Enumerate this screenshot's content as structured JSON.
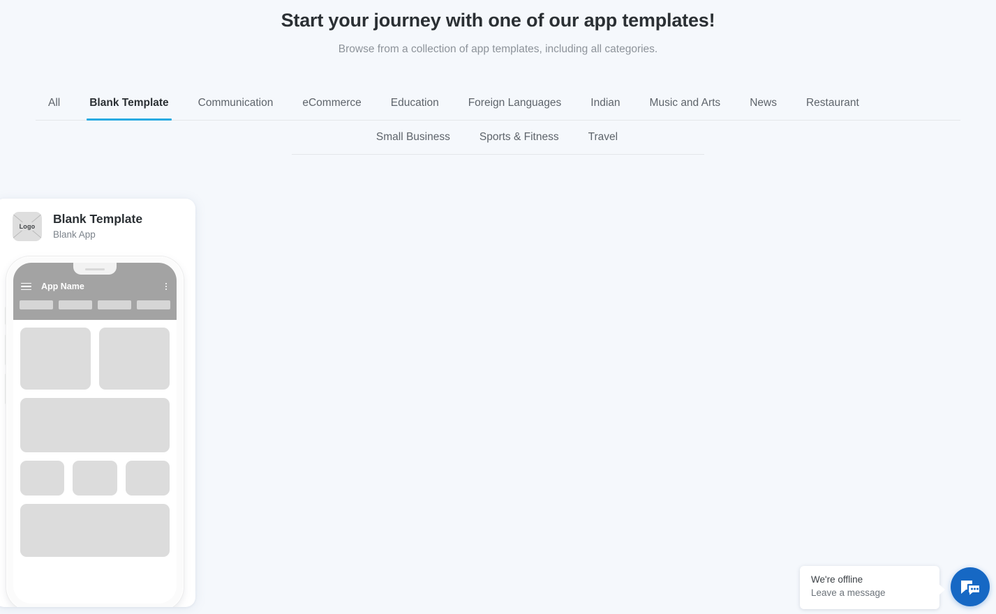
{
  "header": {
    "title": "Start your journey with one of our app templates!",
    "subtitle": "Browse from a collection of app templates, including all categories."
  },
  "tabs": {
    "row1": [
      {
        "label": "All",
        "active": false
      },
      {
        "label": "Blank Template",
        "active": true
      },
      {
        "label": "Communication",
        "active": false
      },
      {
        "label": "eCommerce",
        "active": false
      },
      {
        "label": "Education",
        "active": false
      },
      {
        "label": "Foreign Languages",
        "active": false
      },
      {
        "label": "Indian",
        "active": false
      },
      {
        "label": "Music and Arts",
        "active": false
      },
      {
        "label": "News",
        "active": false
      },
      {
        "label": "Restaurant",
        "active": false
      }
    ],
    "row2": [
      {
        "label": "Small Business",
        "active": false
      },
      {
        "label": "Sports & Fitness",
        "active": false
      },
      {
        "label": "Travel",
        "active": false
      }
    ],
    "active_accent_color": "#29abe2"
  },
  "template_card": {
    "logo_placeholder_label": "Logo",
    "title": "Blank Template",
    "subtitle": "Blank App",
    "phone_preview": {
      "app_bar_title": "App Name",
      "menu_icon": "hamburger-icon",
      "overflow_icon": "kebab-menu-icon",
      "tab_count": 4,
      "content_blocks": [
        {
          "type": "row",
          "items": 2
        },
        {
          "type": "full",
          "items": 1
        },
        {
          "type": "row",
          "items": 3
        },
        {
          "type": "full",
          "items": 1
        }
      ]
    }
  },
  "chat_widget": {
    "line1": "We're offline",
    "line2": "Leave a message",
    "button_icon": "chat-bubbles-icon",
    "button_color": "#1668c4"
  }
}
